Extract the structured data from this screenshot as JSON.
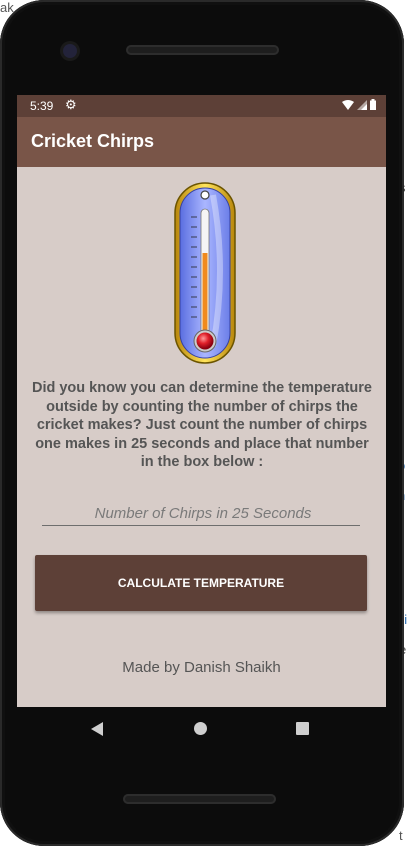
{
  "background_fragments": [
    "ak",
    "t",
    "s",
    "o",
    "n",
    "ei",
    "e",
    "t"
  ],
  "status_bar": {
    "time": "5:39",
    "settings_icon": "gear-icon",
    "icons": [
      "wifi-icon",
      "signal-icon",
      "battery-icon"
    ]
  },
  "app_bar": {
    "title": "Cricket Chirps"
  },
  "main": {
    "thermometer_icon": "thermometer-icon",
    "description": "Did you know you can determine the temperature outside by counting the number of chirps the cricket makes? Just count the number of chirps one makes in 25 seconds and place that number in the box below :",
    "chirps_input": {
      "placeholder": "Number of Chirps in 25 Seconds",
      "value": ""
    },
    "calculate_label": "CALCULATE TEMPERATURE",
    "credit": "Made by Danish Shaikh"
  },
  "nav_bar": {
    "buttons": [
      "back",
      "home",
      "recents"
    ]
  },
  "colors": {
    "status_bar": "#5d4037",
    "app_bar": "#795548",
    "screen_background": "#d7ccc8",
    "button": "#5d4037"
  }
}
